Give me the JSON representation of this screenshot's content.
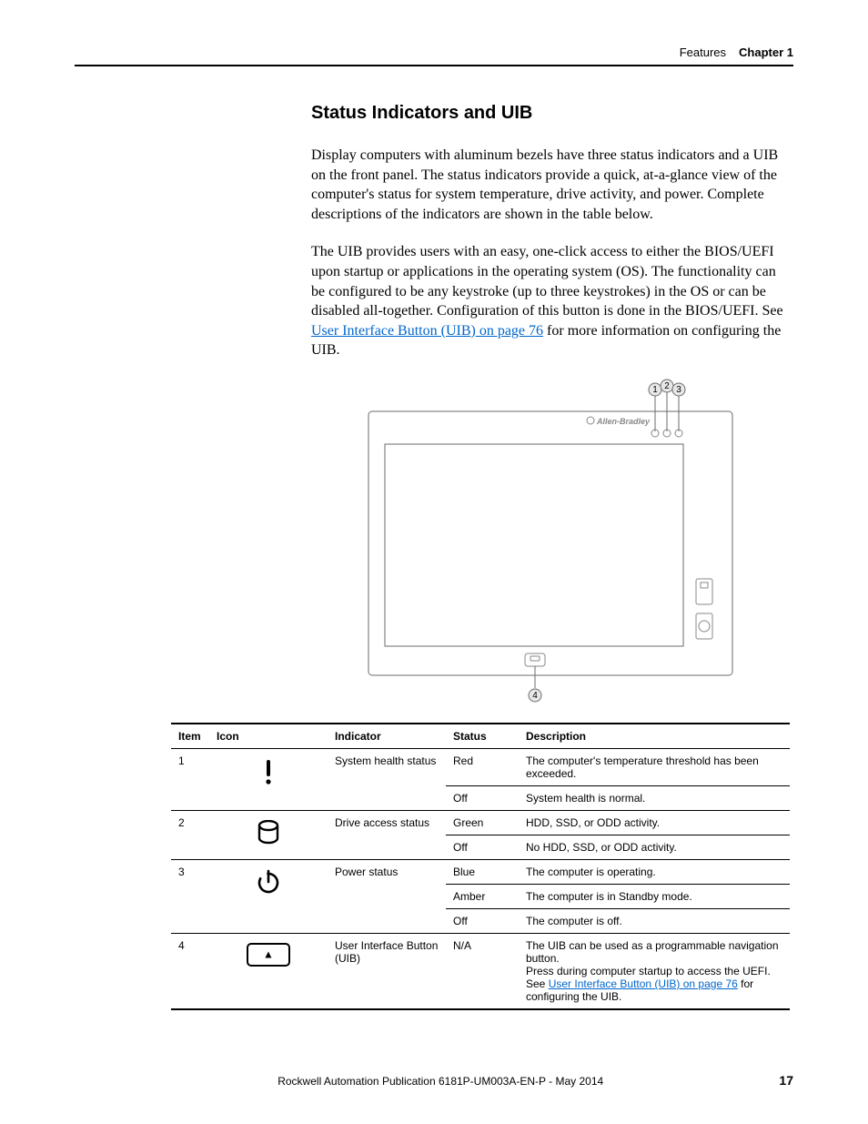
{
  "header": {
    "section": "Features",
    "chapter": "Chapter 1"
  },
  "title": "Status Indicators and UIB",
  "p1": "Display computers with aluminum bezels have three status indicators and a UIB on the front panel. The status indicators provide a quick, at-a-glance view of the computer's status for system temperature, drive activity, and power. Complete descriptions of the indicators are shown in the table below.",
  "p2a": "The UIB provides users with an easy, one-click access to either the BIOS/UEFI upon startup or applications in the operating system (OS). The functionality can be configured to be any keystroke (up to three keystrokes) in the OS or can be disabled all-together. Configuration of this button is done in the BIOS/UEFI. See ",
  "p2link": "User Interface Button (UIB) on page 76",
  "p2b": " for more information on configuring the UIB.",
  "diagram": {
    "brand": "Allen-Bradley",
    "c1": "1",
    "c2": "2",
    "c3": "3",
    "c4": "4"
  },
  "table": {
    "h_item": "Item",
    "h_icon": "Icon",
    "h_ind": "Indicator",
    "h_stat": "Status",
    "h_desc": "Description",
    "r1_item": "1",
    "r1_ind": "System health status",
    "r1a_stat": "Red",
    "r1a_desc": "The computer's temperature threshold has been exceeded.",
    "r1b_stat": "Off",
    "r1b_desc": "System health is normal.",
    "r2_item": "2",
    "r2_ind": "Drive access status",
    "r2a_stat": "Green",
    "r2a_desc": "HDD, SSD, or ODD activity.",
    "r2b_stat": "Off",
    "r2b_desc": "No HDD, SSD, or ODD activity.",
    "r3_item": "3",
    "r3_ind": "Power status",
    "r3a_stat": "Blue",
    "r3a_desc": "The computer is operating.",
    "r3b_stat": "Amber",
    "r3b_desc": "The computer is in Standby mode.",
    "r3c_stat": "Off",
    "r3c_desc": "The computer is off.",
    "r4_item": "4",
    "r4_ind": "User Interface Button (UIB)",
    "r4_stat": "N/A",
    "r4_desc_l1": "The UIB can be used as a programmable navigation button.",
    "r4_desc_l2": "Press during computer startup to access the UEFI.",
    "r4_desc_l3a": "See ",
    "r4_desc_link": "User Interface Button (UIB) on page 76",
    "r4_desc_l3b": " for configuring the UIB."
  },
  "footer": {
    "pub": "Rockwell Automation Publication 6181P-UM003A-EN-P - May 2014",
    "page": "17"
  }
}
